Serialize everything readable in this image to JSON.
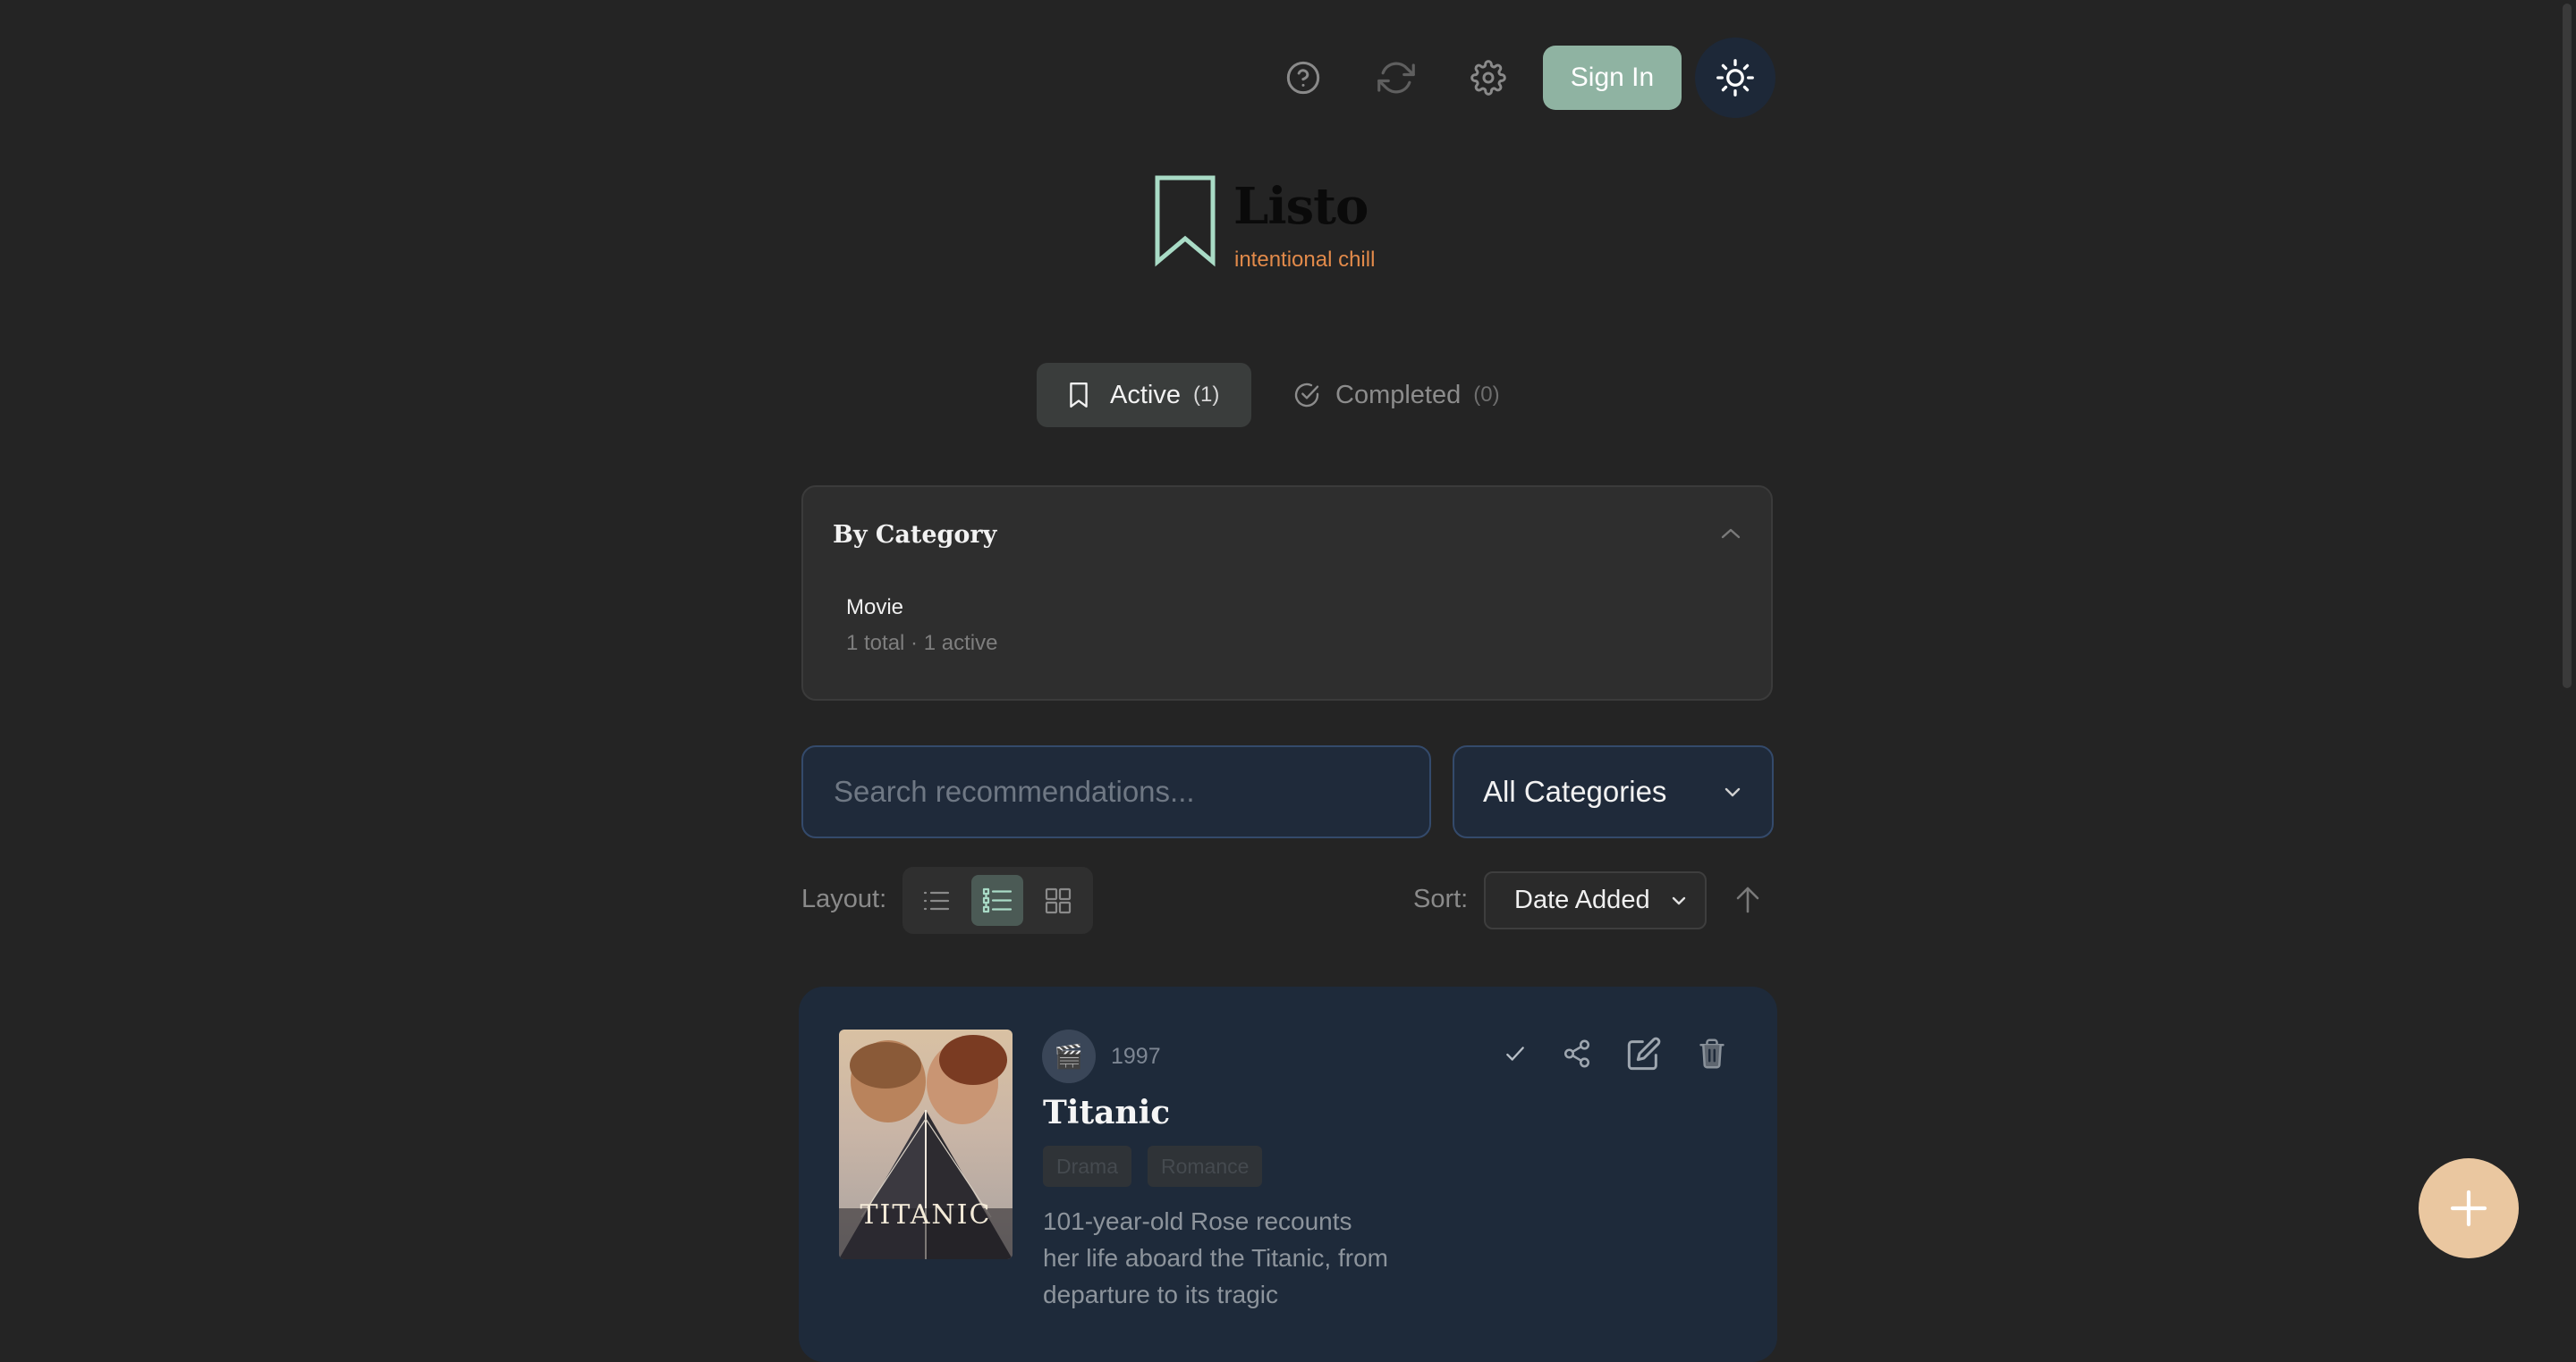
{
  "toolbar": {
    "help_icon": "help-circle-icon",
    "refresh_icon": "refresh-icon",
    "settings_icon": "gear-icon",
    "sign_in_label": "Sign In",
    "theme_icon": "sun-icon"
  },
  "brand": {
    "name": "Listo",
    "tagline": "intentional chill",
    "logo_icon": "bookmark-icon"
  },
  "tabs": [
    {
      "label": "Active",
      "count": "(1)",
      "icon": "bookmark-icon",
      "active": true
    },
    {
      "label": "Completed",
      "count": "(0)",
      "icon": "check-circle-icon",
      "active": false
    }
  ],
  "category_panel": {
    "title": "By Category",
    "expanded": true,
    "categories": [
      {
        "name": "Movie",
        "stats": "1 total · 1 active"
      }
    ]
  },
  "search": {
    "placeholder": "Search recommendations...",
    "value": ""
  },
  "category_filter": {
    "selected": "All Categories"
  },
  "layout": {
    "label": "Layout:",
    "options": [
      "list",
      "detailed-list",
      "grid"
    ],
    "selected": "detailed-list"
  },
  "sort": {
    "label": "Sort:",
    "selected": "Date Added",
    "direction": "ascending"
  },
  "items": [
    {
      "title": "Titanic",
      "year": "1997",
      "category_icon": "clapperboard-icon",
      "category_glyph": "🎬",
      "tags": [
        "Drama",
        "Romance"
      ],
      "description": "101-year-old Rose recounts her life aboard the Titanic, from departure to its tragic",
      "poster_text": "TITANIC",
      "actions": [
        "complete",
        "share",
        "edit",
        "delete"
      ]
    }
  ],
  "colors": {
    "background": "#242424",
    "accent": "#8fb3a2",
    "brand_tagline": "#e28a4a",
    "card": "#1e2a3a",
    "fab": "#eac7a0"
  }
}
